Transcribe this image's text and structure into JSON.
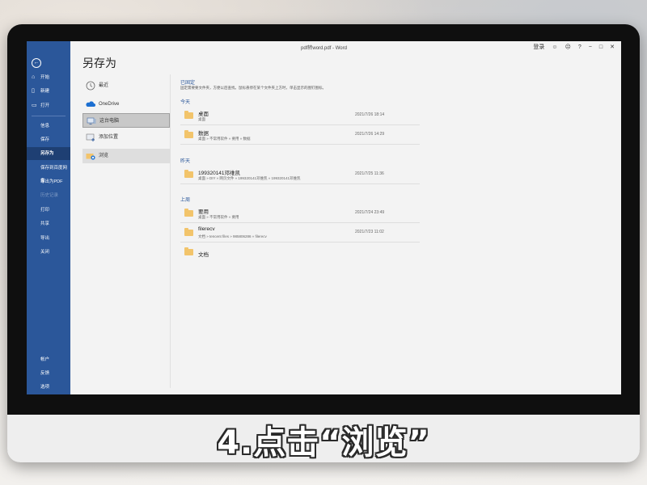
{
  "window": {
    "title": "pdf转word.pdf  -  Word",
    "signin_label": "登录",
    "help_label": "?"
  },
  "nav": {
    "top_items": [
      {
        "label": "开始",
        "icon": "home-icon"
      },
      {
        "label": "新建",
        "icon": "new-doc-icon"
      },
      {
        "label": "打开",
        "icon": "folder-open-icon"
      }
    ],
    "items": [
      {
        "label": "信息"
      },
      {
        "label": "保存"
      },
      {
        "label": "另存为"
      },
      {
        "label": "保存到百度网盘"
      },
      {
        "label": "导出为PDF"
      },
      {
        "label": "历史记录"
      },
      {
        "label": "打印"
      },
      {
        "label": "共享"
      },
      {
        "label": "导出"
      },
      {
        "label": "关闭"
      }
    ],
    "bottom_items": [
      {
        "label": "帐户"
      },
      {
        "label": "反馈"
      },
      {
        "label": "选项"
      }
    ]
  },
  "main": {
    "heading": "另存为",
    "locations": [
      {
        "label": "最近",
        "icon": "clock-icon"
      },
      {
        "label": "OneDrive",
        "icon": "cloud-icon"
      },
      {
        "label": "这台电脑",
        "icon": "computer-icon"
      },
      {
        "label": "添加位置",
        "icon": "add-location-icon"
      },
      {
        "label": "浏览",
        "icon": "browse-folder-icon"
      }
    ]
  },
  "recent": {
    "pinned_title": "已固定",
    "pinned_desc": "固定需要要文件夹，方便以后查找。鼠标悬停在某个文件夹上方时，单击显示的图钉图标。",
    "groups": [
      {
        "title": "今天",
        "items": [
          {
            "name": "桌面",
            "path": "桌面",
            "date": "2021/7/26 18:14"
          },
          {
            "name": "数据",
            "path": "桌面 » 不常用软件 » 要用 » 数据",
            "date": "2021/7/26 14:29"
          }
        ]
      },
      {
        "title": "昨天",
        "items": [
          {
            "name": "199320141邓维凯",
            "path": "桌面 » DIY » 网页文件 » 199320141邓维凯 » 199320141邓维凯",
            "date": "2021/7/25 11:36"
          }
        ]
      },
      {
        "title": "上周",
        "items": [
          {
            "name": "要用",
            "path": "桌面 » 不常用软件 » 要用",
            "date": "2021/7/24 23:49"
          },
          {
            "name": "filerecv",
            "path": "文档 » tencent files » 985806286 » filerecv",
            "date": "2021/7/23 11:02"
          },
          {
            "name": "文档",
            "path": "",
            "date": ""
          }
        ]
      }
    ]
  },
  "caption": "4.点击“浏览”"
}
